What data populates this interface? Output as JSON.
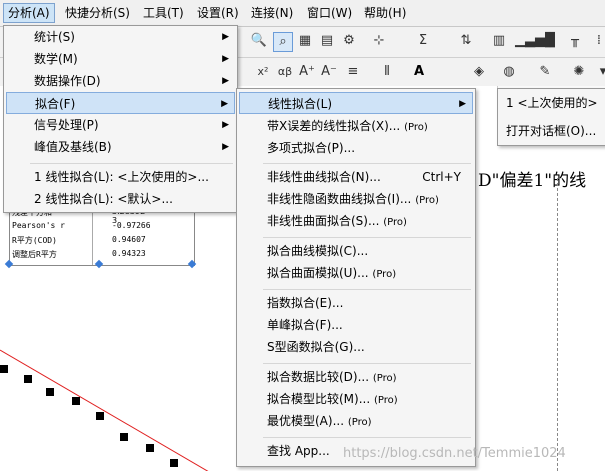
{
  "menubar": {
    "items": [
      {
        "label": "分析(A)"
      },
      {
        "label": "快捷分析(S)"
      },
      {
        "label": "工具(T)"
      },
      {
        "label": "设置(R)"
      },
      {
        "label": "连接(N)"
      },
      {
        "label": "窗口(W)"
      },
      {
        "label": "帮助(H)"
      }
    ]
  },
  "toolbar": {
    "icons": [
      "zoom-icon",
      "zoom-box-icon",
      "grid-icon",
      "worksheet-icon",
      "gear-icon",
      "sigma-icon",
      "sort-icon",
      "bar-chart-icon",
      "stats-icon",
      "x-squared-icon",
      "alpha-beta-icon",
      "font-size-up-icon",
      "font-size-down-icon",
      "align-icon",
      "font-color-icon",
      "fill-icon",
      "line-icon",
      "pen-icon",
      "sun-icon"
    ]
  },
  "analysis_menu": {
    "items": [
      {
        "label": "统计(S)",
        "has_submenu": true
      },
      {
        "label": "数学(M)",
        "has_submenu": true
      },
      {
        "label": "数据操作(D)",
        "has_submenu": true
      },
      {
        "label": "拟合(F)",
        "has_submenu": true,
        "selected": true
      },
      {
        "label": "信号处理(P)",
        "has_submenu": true
      },
      {
        "label": "峰值及基线(B)",
        "has_submenu": true
      }
    ],
    "recent": [
      {
        "label": "1 线性拟合(L): <上次使用的>..."
      },
      {
        "label": "2 线性拟合(L): <默认>..."
      }
    ]
  },
  "fit_menu": {
    "items": [
      {
        "label": "线性拟合(L)",
        "has_submenu": true,
        "selected": true
      },
      {
        "label": "带X误差的线性拟合(X)...",
        "pro": "(Pro)"
      },
      {
        "label": "多项式拟合(P)..."
      },
      {
        "label": "非线性曲线拟合(N)...",
        "shortcut": "Ctrl+Y"
      },
      {
        "label": "非线性隐函数曲线拟合(I)...",
        "pro": "(Pro)"
      },
      {
        "label": "非线性曲面拟合(S)...",
        "pro": "(Pro)"
      },
      {
        "label": "拟合曲线模拟(C)..."
      },
      {
        "label": "拟合曲面模拟(U)...",
        "pro": "(Pro)"
      },
      {
        "label": "指数拟合(E)..."
      },
      {
        "label": "单峰拟合(F)..."
      },
      {
        "label": "S型函数拟合(G)..."
      },
      {
        "label": "拟合数据比较(D)...",
        "pro": "(Pro)"
      },
      {
        "label": "拟合模型比较(M)...",
        "pro": "(Pro)"
      },
      {
        "label": "最优模型(A)...",
        "pro": "(Pro)"
      },
      {
        "label": "查找 App..."
      }
    ]
  },
  "linear_fit_submenu": {
    "items": [
      {
        "label": "1 <上次使用的>"
      },
      {
        "label": "打开对话框(O)..."
      }
    ]
  },
  "result_table": {
    "rows": [
      {
        "name": "残差平方和",
        "value": "3.2839E-3"
      },
      {
        "name": "Pearson's r",
        "value": "-0.97266"
      },
      {
        "name": "R平方(COD)",
        "value": "0.94607"
      },
      {
        "name": "调整后R平方",
        "value": "0.94323"
      }
    ]
  },
  "graph_title_fragment": "D\"偏差1\"的线",
  "watermark": "https://blog.csdn.net/Temmie1024"
}
